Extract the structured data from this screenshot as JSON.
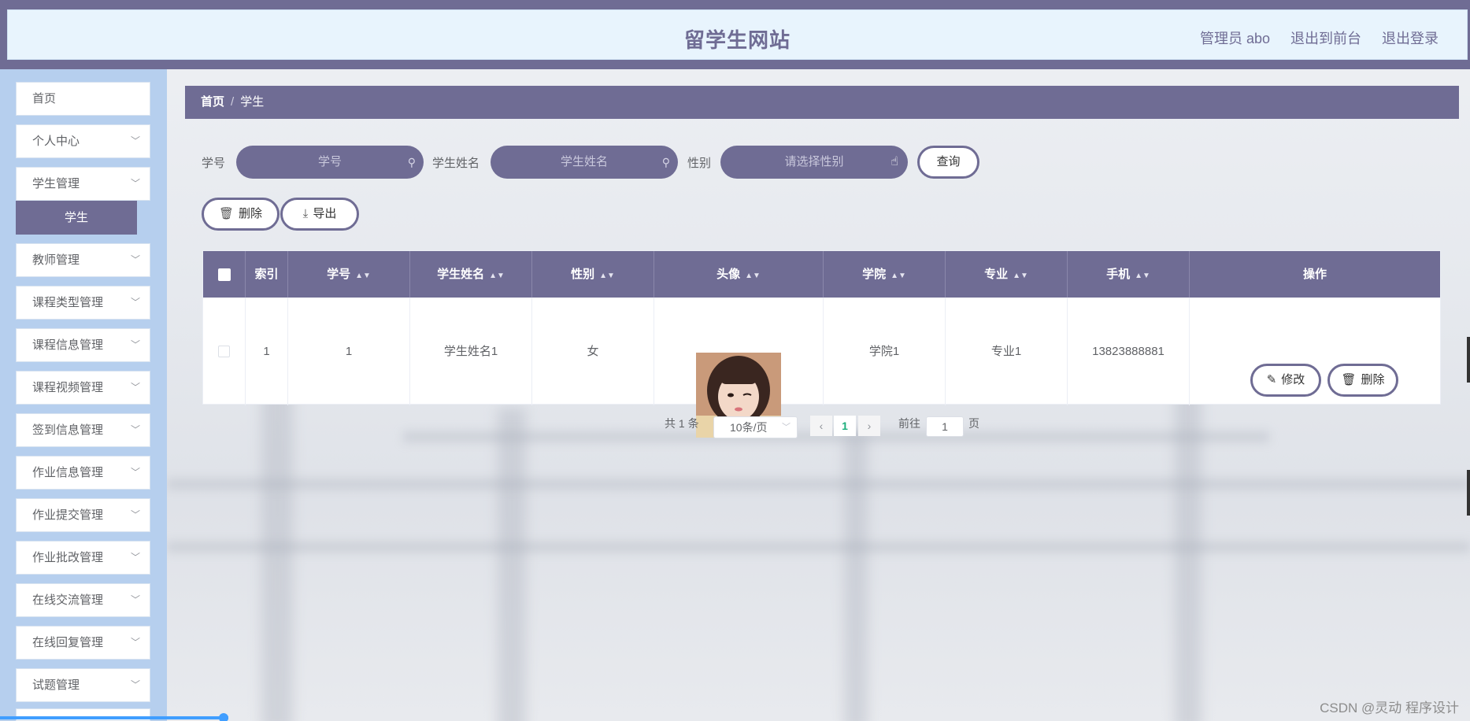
{
  "header": {
    "title": "留学生网站",
    "user_label": "管理员 abo",
    "front_link": "退出到前台",
    "logout_link": "退出登录"
  },
  "sidebar": {
    "items": [
      {
        "label": "首页"
      },
      {
        "label": "个人中心"
      },
      {
        "label": "学生管理"
      },
      {
        "label": "学生"
      },
      {
        "label": "教师管理"
      },
      {
        "label": "课程类型管理"
      },
      {
        "label": "课程信息管理"
      },
      {
        "label": "课程视频管理"
      },
      {
        "label": "签到信息管理"
      },
      {
        "label": "作业信息管理"
      },
      {
        "label": "作业提交管理"
      },
      {
        "label": "作业批改管理"
      },
      {
        "label": "在线交流管理"
      },
      {
        "label": "在线回复管理"
      },
      {
        "label": "试题管理"
      }
    ]
  },
  "breadcrumb": {
    "home": "首页",
    "sep": "/",
    "current": "学生"
  },
  "search": {
    "xuehao_label": "学号",
    "xuehao_placeholder": "学号",
    "name_label": "学生姓名",
    "name_placeholder": "学生姓名",
    "gender_label": "性别",
    "gender_placeholder": "请选择性别",
    "query_button": "查询"
  },
  "actions": {
    "delete": "删除",
    "export": "导出"
  },
  "table": {
    "headers": [
      "索引",
      "学号",
      "学生姓名",
      "性别",
      "头像",
      "学院",
      "专业",
      "手机",
      "操作"
    ],
    "rows": [
      {
        "index": "1",
        "xuehao": "1",
        "name": "学生姓名1",
        "gender": "女",
        "college": "学院1",
        "major": "专业1",
        "phone": "13823888881",
        "edit": "修改",
        "delete": "删除"
      }
    ]
  },
  "pagination": {
    "total": "共 1 条",
    "page_size": "10条/页",
    "current_page": "1",
    "goto_label": "前往",
    "goto_value": "1",
    "page_suffix": "页"
  },
  "watermark": "CSDN @灵动 程序设计",
  "colors": {
    "primary": "#6f6c94",
    "sidebar_bg": "#b6cfee",
    "header_bg": "#e8f4fd"
  }
}
